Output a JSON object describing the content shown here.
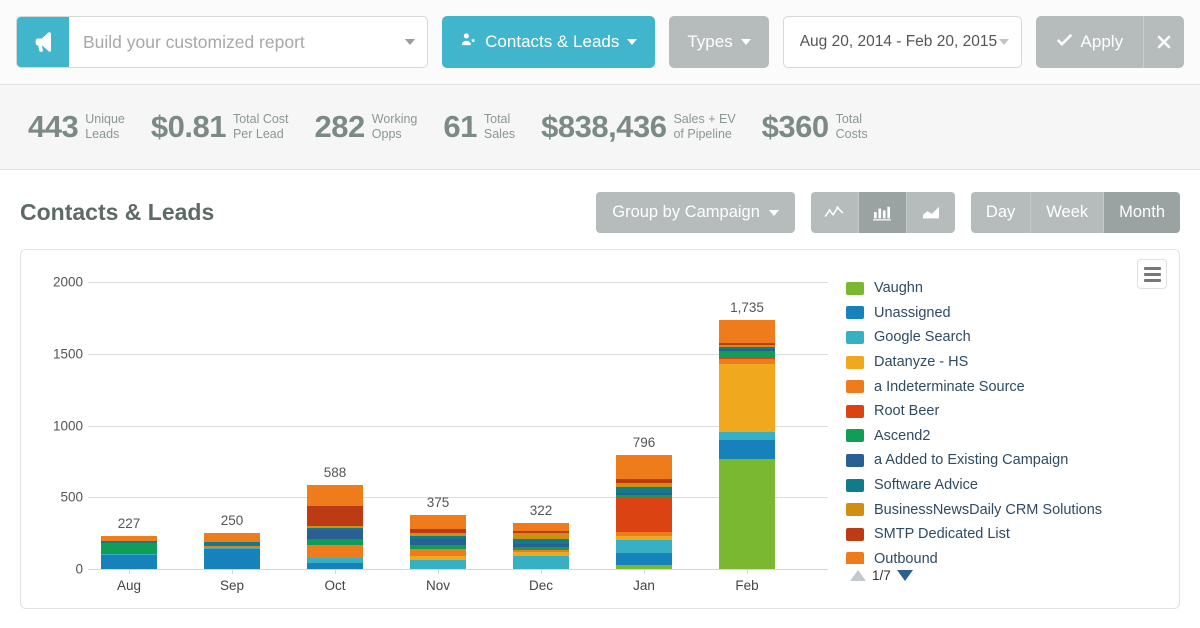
{
  "toolbar": {
    "logo_icon": "megaphone-icon",
    "search_placeholder": "Build your customized report",
    "search_value": "",
    "contacts_leads_label": "Contacts & Leads",
    "contacts_leads_icon": "user-star-icon",
    "types_label": "Types",
    "date_range": "Aug 20, 2014 - Feb 20, 2015",
    "apply_label": "Apply",
    "apply_icon": "check-icon",
    "close_icon": "close-icon",
    "teal": "#40b5cc",
    "gray": "#b6bcbc"
  },
  "kpis": [
    {
      "value": "443",
      "label_line1": "Unique",
      "label_line2": "Leads"
    },
    {
      "value": "$0.81",
      "label_line1": "Total Cost",
      "label_line2": "Per Lead"
    },
    {
      "value": "282",
      "label_line1": "Working",
      "label_line2": "Opps"
    },
    {
      "value": "61",
      "label_line1": "Total",
      "label_line2": "Sales"
    },
    {
      "value": "$838,436",
      "label_line1": "Sales + EV",
      "label_line2": "of Pipeline"
    },
    {
      "value": "$360",
      "label_line1": "Total",
      "label_line2": "Costs"
    }
  ],
  "section": {
    "title": "Contacts & Leads",
    "group_by_label": "Group by Campaign",
    "chart_types": [
      {
        "name": "line-chart-icon",
        "active": false
      },
      {
        "name": "bar-chart-icon",
        "active": true
      },
      {
        "name": "area-chart-icon",
        "active": false
      }
    ],
    "intervals": [
      {
        "label": "Day",
        "active": false
      },
      {
        "label": "Week",
        "active": false
      },
      {
        "label": "Month",
        "active": true
      }
    ],
    "menu_icon": "hamburger-menu-icon"
  },
  "legend_nav": {
    "page_text": "1/7",
    "up_icon": "triangle-up-icon",
    "down_icon": "triangle-down-icon"
  },
  "chart_data": {
    "type": "bar",
    "stacked": true,
    "title": "Contacts & Leads",
    "xlabel": "",
    "ylabel": "",
    "ylim": [
      0,
      2000
    ],
    "yticks": [
      0,
      500,
      1000,
      1500,
      2000
    ],
    "grid": true,
    "legend_position": "right",
    "categories": [
      "Aug",
      "Sep",
      "Oct",
      "Nov",
      "Dec",
      "Jan",
      "Feb"
    ],
    "totals": [
      227,
      250,
      588,
      375,
      322,
      796,
      1735
    ],
    "total_labels": [
      "227",
      "250",
      "588",
      "375",
      "322",
      "796",
      "1,735"
    ],
    "series": [
      {
        "name": "Vaughn",
        "color": "#7ab832",
        "values": [
          0,
          0,
          0,
          0,
          0,
          28,
          770
        ]
      },
      {
        "name": "Unassigned",
        "color": "#1681ba",
        "values": [
          96,
          140,
          40,
          0,
          0,
          84,
          130
        ]
      },
      {
        "name": "Google Search",
        "color": "#36b0c2",
        "values": [
          10,
          6,
          34,
          60,
          90,
          93,
          55
        ]
      },
      {
        "name": "Datanyze - HS",
        "color": "#f0a81e",
        "values": [
          0,
          0,
          0,
          30,
          28,
          22,
          475
        ]
      },
      {
        "name": "a Indeterminate Source",
        "color": "#ef7c1b",
        "values": [
          0,
          12,
          96,
          50,
          14,
          30,
          32
        ]
      },
      {
        "name": "Root Beer",
        "color": "#dc4312",
        "values": [
          0,
          0,
          0,
          0,
          0,
          242,
          18
        ]
      },
      {
        "name": "Ascend2",
        "color": "#0f9d58",
        "values": [
          74,
          0,
          40,
          30,
          22,
          14,
          40
        ]
      },
      {
        "name": "a Added to Existing Campaign",
        "color": "#2a5f94",
        "values": [
          0,
          0,
          60,
          36,
          22,
          16,
          12
        ]
      },
      {
        "name": "Software Advice",
        "color": "#117a8b",
        "values": [
          14,
          30,
          18,
          24,
          30,
          46,
          18
        ]
      },
      {
        "name": "BusinessNewsDaily CRM Solutions",
        "color": "#cf8f10",
        "values": [
          0,
          8,
          14,
          22,
          44,
          26,
          14
        ]
      },
      {
        "name": "SMTP Dedicated List",
        "color": "#bc3a14",
        "values": [
          0,
          0,
          140,
          26,
          14,
          26,
          12
        ]
      },
      {
        "name": "Outbound",
        "color": "#ef7c1b",
        "values": [
          33,
          54,
          146,
          97,
          58,
          169,
          159
        ]
      }
    ]
  }
}
